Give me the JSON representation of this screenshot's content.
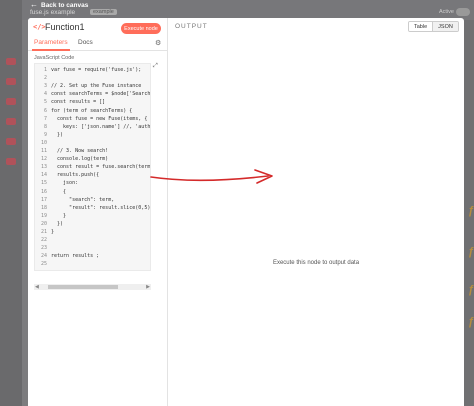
{
  "background": {
    "node_subtitle": "fuse.js example",
    "badge": "example",
    "active_label": "Active"
  },
  "back_link": {
    "label": "Back to canvas"
  },
  "node": {
    "icon": "</>",
    "title": "Function1",
    "execute_label": "Execute node"
  },
  "tabs": [
    {
      "label": "Parameters",
      "active": true
    },
    {
      "label": "Docs",
      "active": false
    }
  ],
  "editor": {
    "language_label": "JavaScript Code",
    "lines": [
      "var fuse = require('fuse.js');",
      "",
      "// 2. Set up the Fuse instance",
      "const searchTerms = $node['SearchTer",
      "const results = []",
      "for (term of searchTerms) {",
      "  const fuse = new Fuse(items, {",
      "    keys: ['json.name'] //, 'author.",
      "  })",
      "",
      "  // 3. Now search!",
      "  console.log(term)",
      "  const result = fuse.search(term)",
      "  results.push({",
      "    json:",
      "    {",
      "      \"search\": term,",
      "      \"result\": result.slice(0,5)",
      "    }",
      "  })",
      "}",
      "",
      "",
      "return results ;",
      ""
    ]
  },
  "output": {
    "title": "OUTPUT",
    "view_options": [
      "Table",
      "JSON"
    ],
    "selected_view": "JSON",
    "empty_message": "Execute this node to output data"
  },
  "colors": {
    "accent": "#ff6d5a",
    "annotation": "#d42a2a"
  },
  "icons": {
    "back": "arrow-left-icon",
    "settings": "gear-icon",
    "expand": "expand-icon"
  }
}
